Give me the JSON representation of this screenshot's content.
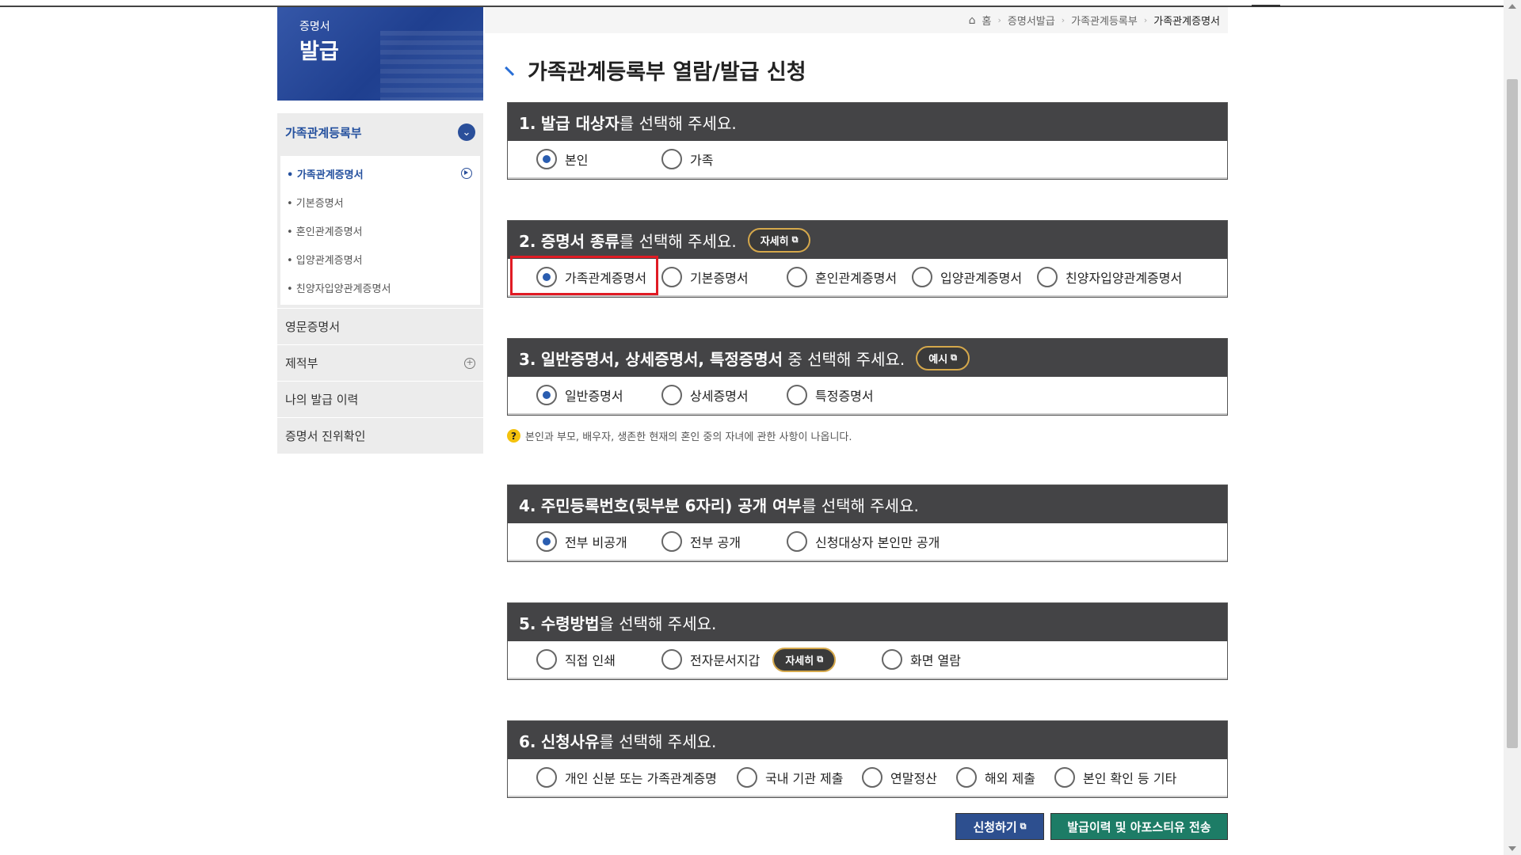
{
  "sidebar": {
    "banner_sub": "증명서",
    "banner_main": "발급",
    "group_label": "가족관계등록부",
    "sub_items": [
      {
        "label": "• 가족관계증명서",
        "active": true
      },
      {
        "label": "• 기본증명서"
      },
      {
        "label": "• 혼인관계증명서"
      },
      {
        "label": "• 입양관계증명서"
      },
      {
        "label": "• 친양자입양관계증명서"
      }
    ],
    "items": [
      "영문증명서",
      "제적부",
      "나의 발급 이력",
      "증명서 진위확인"
    ]
  },
  "breadcrumb": [
    "홈",
    "증명서발급",
    "가족관계등록부",
    "가족관계증명서"
  ],
  "page_title": "가족관계등록부 열람/발급 신청",
  "sections": [
    {
      "num": "1.",
      "bold": "발급 대상자",
      "rest": "를 선택해 주세요.",
      "options": [
        "본인",
        "가족"
      ],
      "selected": "본인"
    },
    {
      "num": "2.",
      "bold": "증명서 종류",
      "rest": "를 선택해 주세요.",
      "pill": "자세히",
      "options": [
        "가족관계증명서",
        "기본증명서",
        "혼인관계증명서",
        "입양관계증명서",
        "친양자입양관계증명서"
      ],
      "selected": "가족관계증명서"
    },
    {
      "num": "3.",
      "bold": "일반증명서, 상세증명서, 특정증명서",
      "rest": " 중 선택해 주세요.",
      "pill": "예시",
      "options": [
        "일반증명서",
        "상세증명서",
        "특정증명서"
      ],
      "selected": "일반증명서"
    },
    {
      "num": "4.",
      "bold": "주민등록번호(뒷부분 6자리) 공개 여부",
      "rest": "를 선택해 주세요.",
      "options": [
        "전부 비공개",
        "전부 공개",
        "신청대상자 본인만 공개"
      ],
      "selected": "전부 비공개"
    },
    {
      "num": "5.",
      "bold": "수령방법",
      "rest": "을 선택해 주세요.",
      "options": [
        "직접 인쇄",
        "전자문서지갑",
        "화면 열람"
      ],
      "inline_pill": "자세히"
    },
    {
      "num": "6.",
      "bold": "신청사유",
      "rest": "를 선택해 주세요.",
      "options": [
        "개인 신분 또는 가족관계증명",
        "국내 기관 제출",
        "연말정산",
        "해외 제출",
        "본인 확인 등 기타"
      ]
    }
  ],
  "note": "본인과 부모, 배우자, 생존한 현재의 혼인 중의 자녀에 관한 사항이 나옵니다.",
  "buttons": {
    "apply": "신청하기",
    "send": "발급이력 및 아포스티유 전송"
  },
  "colors": {
    "accent": "#2a5db0",
    "header_bg": "#444446",
    "highlight": "#e01b24",
    "apply_btn": "#2d4f8f",
    "send_btn": "#1d7c66"
  },
  "icons": [
    "home-icon",
    "chevron-down-icon",
    "play-circle-icon",
    "plus-circle-icon",
    "external-link-icon",
    "question-icon"
  ]
}
